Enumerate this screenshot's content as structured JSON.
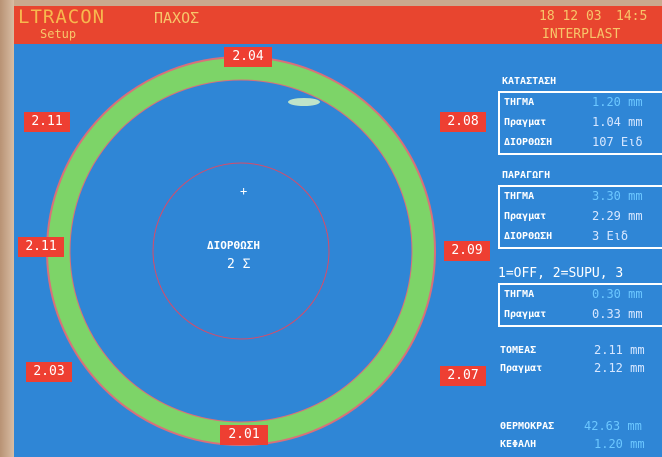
{
  "header": {
    "brand": "LTRACON",
    "menu_label": "Setup",
    "screen_title": "ΠΑΧΟΣ",
    "date": "18 12 03",
    "time": "14:5",
    "company": "INTERPLAST"
  },
  "colors": {
    "screen_bg": "#2f86d6",
    "header_bg": "#e8452f",
    "tag_bg": "#ee3f32",
    "ring_fill": "#7dd468",
    "ring_outline": "#d9707a",
    "value_actual": "#6cc7ff",
    "value_white": "#d7e7ff"
  },
  "gauge": {
    "sensor_labels": {
      "top": "2.04",
      "top_left": "2.11",
      "top_right": "2.08",
      "mid_left": "2.11",
      "mid_right": "2.09",
      "bottom_left": "2.03",
      "bottom_right": "2.07",
      "bottom": "2.01"
    },
    "correction_title": "ΔΙΟΡΘΩΣΗ",
    "correction_value": "2 Σ"
  },
  "status": {
    "title": "ΚΑΤΑΣΤΑΣΗ",
    "rows": [
      {
        "label": "ΤΗΓΜΑ",
        "value": "1.20 mm"
      },
      {
        "label": "Πραγματ",
        "value": "1.04 mm"
      },
      {
        "label": "ΔΙΟΡΘΩΣΗ",
        "value": "107 Ειδ"
      }
    ]
  },
  "production": {
    "title": "ΠΑΡΑΓΩΓΗ",
    "rows": [
      {
        "label": "ΤΗΓΜΑ",
        "value": "3.30 mm"
      },
      {
        "label": "Πραγματ",
        "value": "2.29 mm"
      },
      {
        "label": "ΔΙΟΡΘΩΣΗ",
        "value": "3 Ειδ"
      }
    ]
  },
  "mode": {
    "text": "1=OFF, 2=SUPU, 3"
  },
  "setpoint": {
    "rows": [
      {
        "label": "ΤΗΓΜΑ",
        "value": "0.30 mm"
      },
      {
        "label": "Πραγματ",
        "value": "0.33 mm"
      }
    ]
  },
  "sector": {
    "rows": [
      {
        "label": "ΤΟΜΕΑΣ",
        "value": "2.11 mm"
      },
      {
        "label": "Πραγματ",
        "value": "2.12 mm"
      }
    ]
  },
  "thermal": {
    "rows": [
      {
        "label": "ΘΕΡΜΟΚΡΑΣ",
        "value": "42.63 mm"
      },
      {
        "label": "ΚΕΦΑΛΗ",
        "value": "1.20 mm"
      }
    ]
  }
}
